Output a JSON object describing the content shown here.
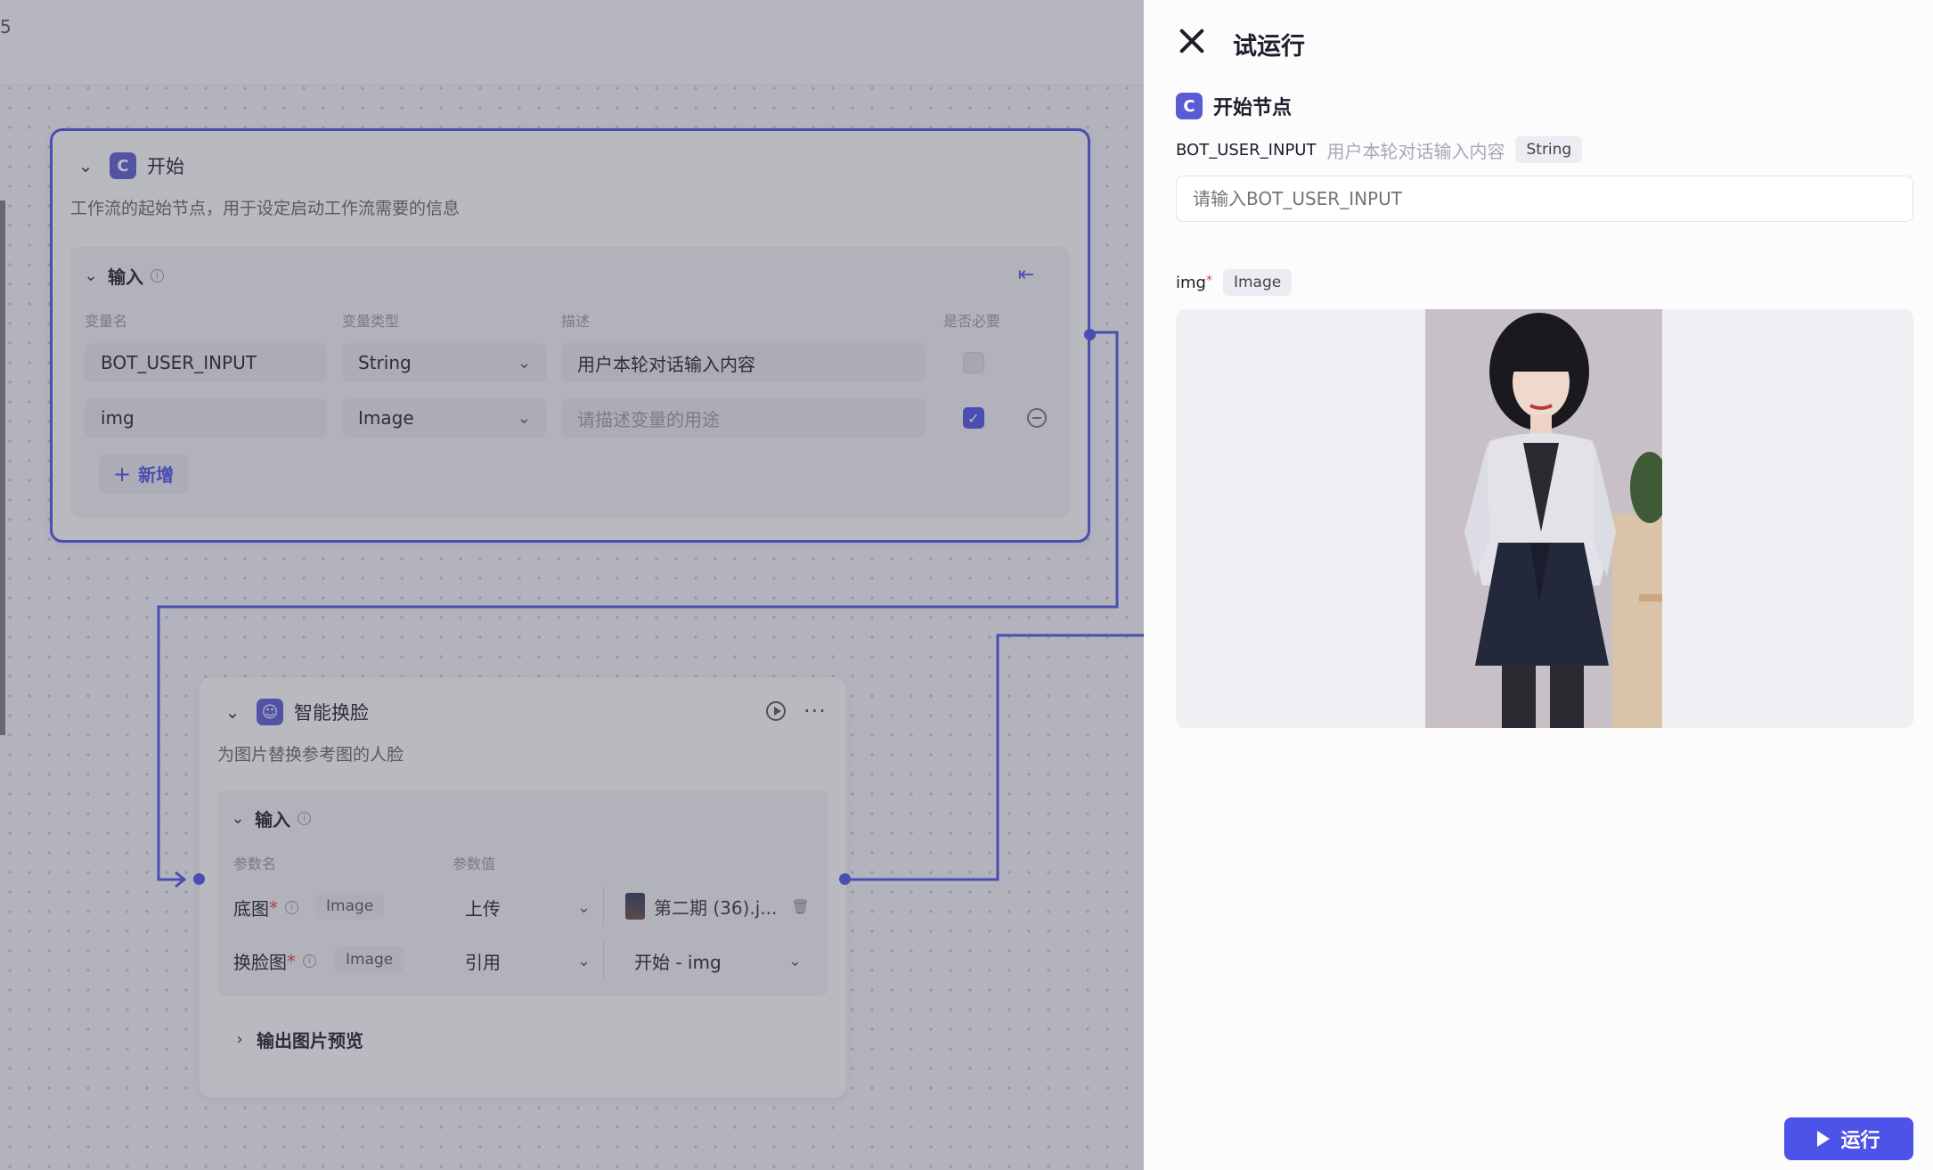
{
  "canvas": {
    "topbar_glyph": "5",
    "start_node": {
      "title": "开始",
      "description": "工作流的起始节点，用于设定启动工作流需要的信息",
      "section_title": "输入",
      "columns": [
        "变量名",
        "变量类型",
        "描述",
        "是否必要"
      ],
      "rows": [
        {
          "name": "BOT_USER_INPUT",
          "type": "String",
          "description": "用户本轮对话输入内容",
          "description_placeholder": false,
          "required": false
        },
        {
          "name": "img",
          "type": "Image",
          "description": "请描述变量的用途",
          "description_placeholder": true,
          "required": true
        }
      ],
      "add_label": "新增"
    },
    "faceswap_node": {
      "title": "智能换脸",
      "description": "为图片替换参考图的人脸",
      "section_title": "输入",
      "columns": [
        "参数名",
        "参数值"
      ],
      "params": [
        {
          "name": "底图",
          "type": "Image",
          "mode": "上传",
          "value": "第二期 (36).j..."
        },
        {
          "name": "换脸图",
          "type": "Image",
          "mode": "引用",
          "value": "开始 - img"
        }
      ],
      "output_section": "输出图片预览"
    }
  },
  "panel": {
    "title": "试运行",
    "start_node_label": "开始节点",
    "bot_user_input": {
      "name": "BOT_USER_INPUT",
      "description": "用户本轮对话输入内容",
      "type": "String",
      "placeholder": "请输入BOT_USER_INPUT"
    },
    "img": {
      "name": "img",
      "required_mark": "*",
      "type": "Image"
    },
    "run_label": "运行"
  },
  "colors": {
    "accent": "#4d53e8",
    "required": "#e04343"
  }
}
